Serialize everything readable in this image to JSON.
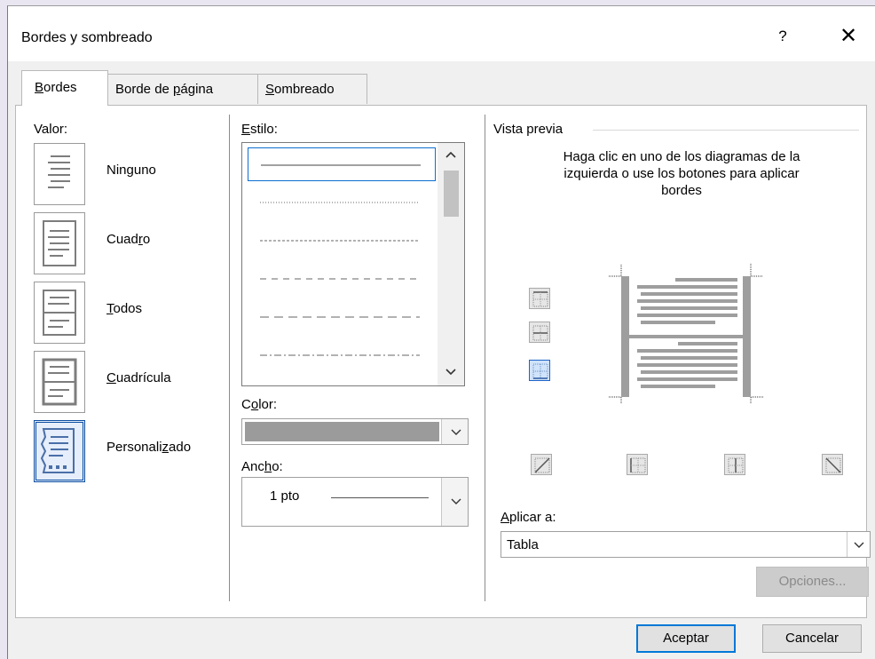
{
  "dialog": {
    "title": "Bordes y sombreado",
    "help_label": "?",
    "close_label": "✕"
  },
  "tabs": {
    "bordes": {
      "label": "Bordes",
      "accel": "B",
      "rest": "ordes"
    },
    "borde_pagina": {
      "pre": "Borde de ",
      "accel": "p",
      "post": "ágina"
    },
    "sombreado": {
      "accel": "S",
      "rest": "ombreado"
    }
  },
  "valor": {
    "label": "Valor:",
    "items": [
      {
        "pre": "Nin",
        "accel": "g",
        "post": "uno"
      },
      {
        "pre": "Cuad",
        "accel": "r",
        "post": "o"
      },
      {
        "pre": "",
        "accel": "T",
        "post": "odos"
      },
      {
        "pre": "",
        "accel": "C",
        "post": "uadrícula"
      },
      {
        "pre": "Personali",
        "accel": "z",
        "post": "ado"
      }
    ]
  },
  "estilo": {
    "accel": "E",
    "rest": "stilo:"
  },
  "color": {
    "pre": "C",
    "accel": "o",
    "post": "lor:",
    "value_color": "#9b9b9b"
  },
  "ancho": {
    "pre": "Anc",
    "accel": "h",
    "post": "o:",
    "value": "1 pto"
  },
  "preview": {
    "label": "Vista previa",
    "instructions": "Haga clic en uno de los diagramas de la izquierda o use los botones para aplicar bordes"
  },
  "aplicar": {
    "accel": "A",
    "rest": "plicar a:",
    "value": "Tabla"
  },
  "buttons": {
    "opciones": "Opciones...",
    "aceptar": "Aceptar",
    "cancelar": "Cancelar"
  },
  "icons": {
    "scroll_up": "chevron-up-icon",
    "scroll_down": "chevron-down-icon",
    "dropdown": "chevron-down-icon"
  },
  "colors": {
    "accent": "#0078d7",
    "selected_border": "#0b4da1"
  }
}
